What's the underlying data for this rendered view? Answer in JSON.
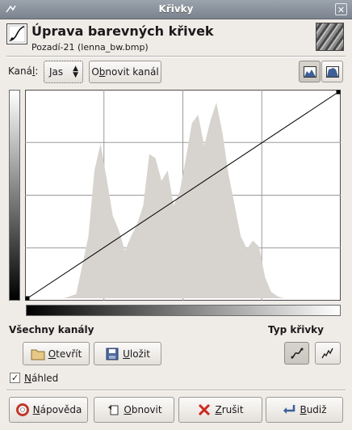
{
  "window": {
    "title": "Křivky"
  },
  "header": {
    "title": "Úprava barevných křivek",
    "subtitle": "Pozadí-21 (lenna_bw.bmp)"
  },
  "channel": {
    "label_prefix": "Kaná",
    "label_key": "l",
    "label_suffix": ":",
    "value": "Jas",
    "reset_prefix": "O",
    "reset_key": "b",
    "reset_suffix": "novit kanál"
  },
  "all_channels_label": "Všechny kanály",
  "curve_type_label": "Typ křivky",
  "open_button": {
    "key": "O",
    "rest": "tevřít"
  },
  "save_button": {
    "key": "U",
    "rest": "ložit"
  },
  "preview": {
    "key": "N",
    "rest": "áhled",
    "checked": true
  },
  "footer": {
    "help": {
      "key": "N",
      "rest": "ápověda"
    },
    "reset": {
      "pre": "",
      "key": "O",
      "rest": "bnovit"
    },
    "cancel": {
      "key": "Z",
      "rest": "rušit"
    },
    "ok": {
      "key": "B",
      "rest": "udiž"
    }
  },
  "chart_data": {
    "type": "area",
    "title": "",
    "xlabel": "",
    "ylabel": "",
    "xlim": [
      0,
      255
    ],
    "ylim": [
      0,
      1
    ],
    "grid": true,
    "curve": {
      "x": [
        0,
        255
      ],
      "y": [
        0,
        255
      ]
    },
    "histogram": {
      "x": [
        0,
        20,
        30,
        40,
        50,
        55,
        60,
        65,
        70,
        75,
        80,
        85,
        90,
        95,
        100,
        105,
        110,
        115,
        120,
        125,
        130,
        135,
        140,
        145,
        150,
        155,
        160,
        165,
        170,
        175,
        180,
        185,
        190,
        195,
        200,
        205,
        210,
        215,
        220,
        230,
        240,
        255
      ],
      "y": [
        0,
        0,
        0,
        0.02,
        0.3,
        0.62,
        0.75,
        0.58,
        0.4,
        0.33,
        0.23,
        0.3,
        0.36,
        0.45,
        0.7,
        0.68,
        0.57,
        0.62,
        0.45,
        0.52,
        0.68,
        0.85,
        0.89,
        0.74,
        0.86,
        0.95,
        0.8,
        0.6,
        0.45,
        0.3,
        0.24,
        0.28,
        0.25,
        0.1,
        0.03,
        0.01,
        0,
        0,
        0,
        0,
        0,
        0
      ]
    }
  }
}
